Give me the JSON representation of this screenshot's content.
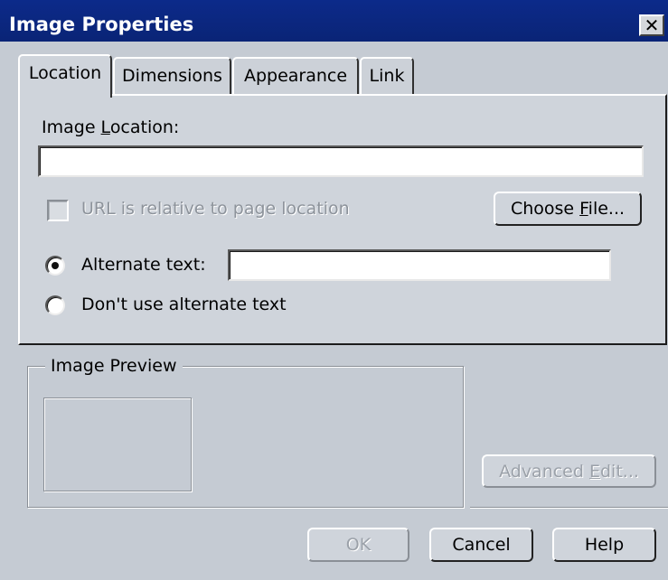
{
  "window": {
    "title": "Image Properties",
    "close_glyph": "✕"
  },
  "tabs": [
    {
      "label": "Location",
      "active": true
    },
    {
      "label": "Dimensions",
      "active": false
    },
    {
      "label": "Appearance",
      "active": false
    },
    {
      "label": "Link",
      "active": false
    }
  ],
  "location": {
    "image_location_label_pre": "Image ",
    "image_location_label_key": "L",
    "image_location_label_post": "ocation:",
    "image_location_value": "",
    "relative_checkbox_label": "URL is relative to page location",
    "relative_checked": false,
    "choose_file_pre": "Choose ",
    "choose_file_key": "F",
    "choose_file_post": "ile...",
    "alt_text_label": "Alternate text:",
    "alt_text_value": "",
    "no_alt_label": "Don't use alternate text",
    "selected_option": "alternate-text"
  },
  "preview": {
    "legend": "Image Preview"
  },
  "buttons": {
    "advanced_edit_pre": "Advanced ",
    "advanced_edit_key": "E",
    "advanced_edit_post": "dit...",
    "ok": "OK",
    "cancel": "Cancel",
    "help": "Help"
  },
  "colors": {
    "titlebar": "#0c2a8a",
    "dialog_bg": "#c5cbd3"
  }
}
